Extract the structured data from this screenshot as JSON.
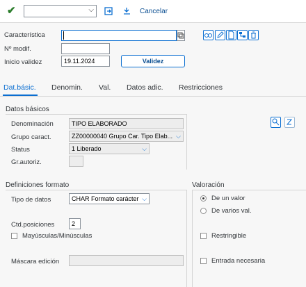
{
  "toolbar": {
    "cancel_label": "Cancelar",
    "command_value": ""
  },
  "header": {
    "caracteristica_label": "Característica",
    "caracteristica_value": "",
    "nmodif_label": "Nº modif.",
    "nmodif_value": "",
    "inicio_label": "Inicio validez",
    "inicio_value": "19.11.2024",
    "validez_button": "Validez"
  },
  "tabs": [
    {
      "label": "Dat.básic."
    },
    {
      "label": "Denomin."
    },
    {
      "label": "Val."
    },
    {
      "label": "Datos adic."
    },
    {
      "label": "Restricciones"
    }
  ],
  "datos_basicos": {
    "title": "Datos básicos",
    "denominacion_label": "Denominación",
    "denominacion_value": "TIPO ELABORADO",
    "grupo_label": "Grupo caract.",
    "grupo_value": "ZZ00000040 Grupo Car. Tipo Elab...",
    "status_label": "Status",
    "status_value": "1 Liberado",
    "grautoriz_label": "Gr.autoriz.",
    "grautoriz_value": ""
  },
  "definiciones": {
    "title": "Definiciones formato",
    "tipo_label": "Tipo de datos",
    "tipo_value": "CHAR Formato carácter",
    "ctd_label": "Ctd.posiciones",
    "ctd_value": "2",
    "mayus_label": "Mayúsculas/Minúsculas",
    "mascara_label": "Máscara edición",
    "mascara_value": ""
  },
  "valoracion": {
    "title": "Valoración",
    "radio1_label": "De un valor",
    "radio2_label": "De varios val.",
    "restringible_label": "Restringible",
    "entrada_label": "Entrada necesaria"
  },
  "colors": {
    "accent": "#0a6ed1",
    "check": "#2b7d2b"
  }
}
